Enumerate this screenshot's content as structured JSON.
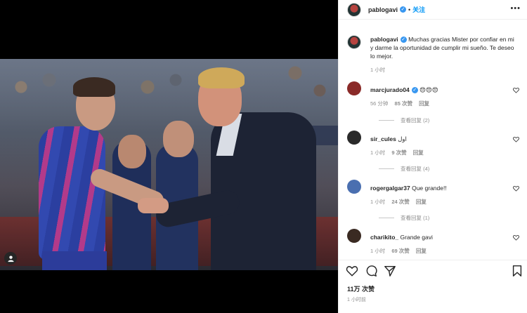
{
  "post": {
    "author": "pablogavi",
    "follow_label": "关注",
    "more_label": "•••",
    "caption": "Muchas gracias Mister por confiar en mi y darme la oportunidad de cumplir mi sueño. Te deseo lo mejor.",
    "caption_time": "1 小时",
    "likes": "11万 次赞",
    "time": "1 小时前"
  },
  "comments": [
    {
      "user": "marcjurado04",
      "verified": true,
      "text": "😍😍😍",
      "time": "56 分钟",
      "likes": "85 次赞",
      "reply": "回复",
      "view_replies": "查看回复 (2)",
      "avatar_color": "#8a2a28"
    },
    {
      "user": "sir_cules",
      "verified": false,
      "text": "اول",
      "time": "1 小时",
      "likes": "9 次赞",
      "reply": "回复",
      "view_replies": "查看回复 (4)",
      "avatar_color": "#2a2a2a"
    },
    {
      "user": "rogergalgar37",
      "verified": false,
      "text": "Que grande!!",
      "time": "1 小时",
      "likes": "24 次赞",
      "reply": "回复",
      "view_replies": "查看回复 (1)",
      "avatar_color": "#4a6fb0"
    },
    {
      "user": "charikito_",
      "verified": false,
      "text": "Grande gavi",
      "time": "1 小时",
      "likes": "69 次赞",
      "reply": "回复",
      "view_replies": "",
      "avatar_color": "#3a2a22"
    }
  ],
  "icons": [
    "heart-icon",
    "comment-icon",
    "share-icon",
    "bookmark-icon",
    "user-tag-icon",
    "verified-badge-icon",
    "more-options-icon"
  ],
  "colors": {
    "link_blue": "#0095f6",
    "verified_blue": "#3897f0",
    "meta_gray": "#8e8e8e",
    "text": "#262626"
  }
}
